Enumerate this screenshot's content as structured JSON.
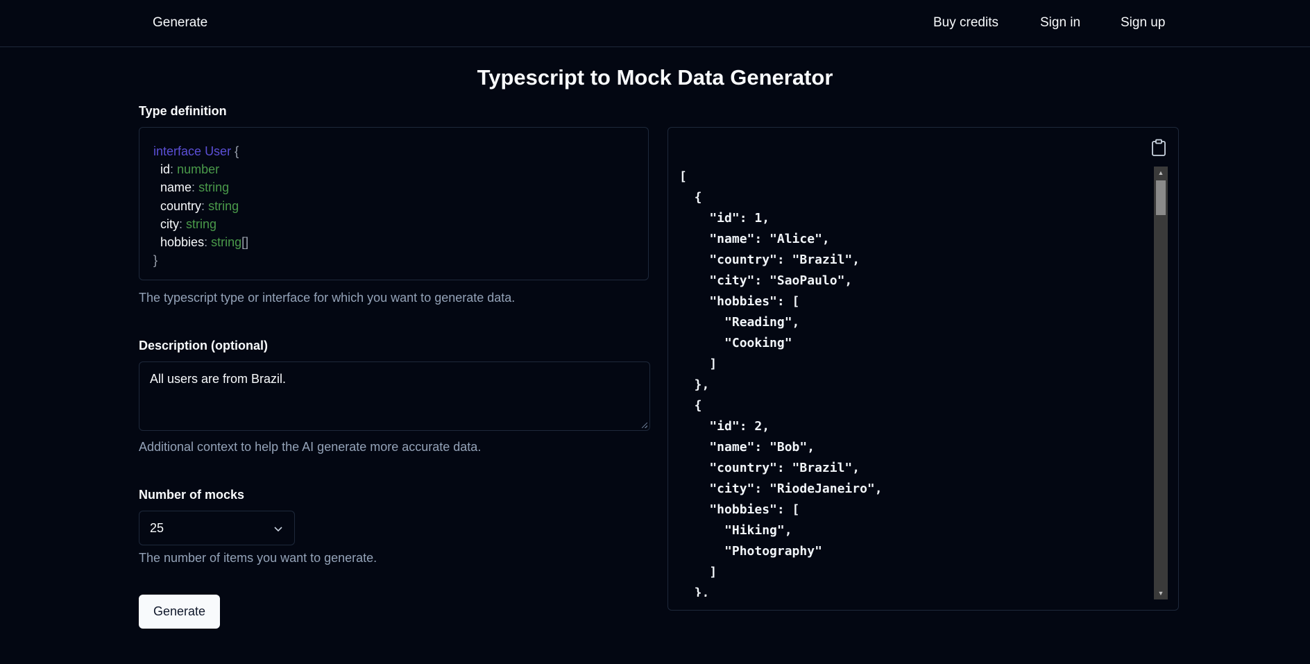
{
  "nav": {
    "brand": "Generate",
    "buy_credits": "Buy credits",
    "sign_in": "Sign in",
    "sign_up": "Sign up"
  },
  "page": {
    "title": "Typescript to Mock Data Generator"
  },
  "type_definition": {
    "label": "Type definition",
    "hint": "The typescript type or interface for which you want to generate data.",
    "code": {
      "keyword": "interface",
      "name": "User",
      "open": "{",
      "close": "}",
      "fields": [
        {
          "name": "id",
          "type": "number"
        },
        {
          "name": "name",
          "type": "string"
        },
        {
          "name": "country",
          "type": "string"
        },
        {
          "name": "city",
          "type": "string"
        },
        {
          "name": "hobbies",
          "type": "string",
          "suffix": "[]"
        }
      ]
    }
  },
  "description": {
    "label": "Description (optional)",
    "value": "All users are from Brazil.",
    "hint": "Additional context to help the AI generate more accurate data."
  },
  "mocks": {
    "label": "Number of mocks",
    "selected": "25",
    "hint": "The number of items you want to generate."
  },
  "generate_button": "Generate",
  "output": {
    "json": "[\n  {\n    \"id\": 1,\n    \"name\": \"Alice\",\n    \"country\": \"Brazil\",\n    \"city\": \"SaoPaulo\",\n    \"hobbies\": [\n      \"Reading\",\n      \"Cooking\"\n    ]\n  },\n  {\n    \"id\": 2,\n    \"name\": \"Bob\",\n    \"country\": \"Brazil\",\n    \"city\": \"RiodeJaneiro\",\n    \"hobbies\": [\n      \"Hiking\",\n      \"Photography\"\n    ]\n  },",
    "copy_icon": "clipboard-icon"
  }
}
